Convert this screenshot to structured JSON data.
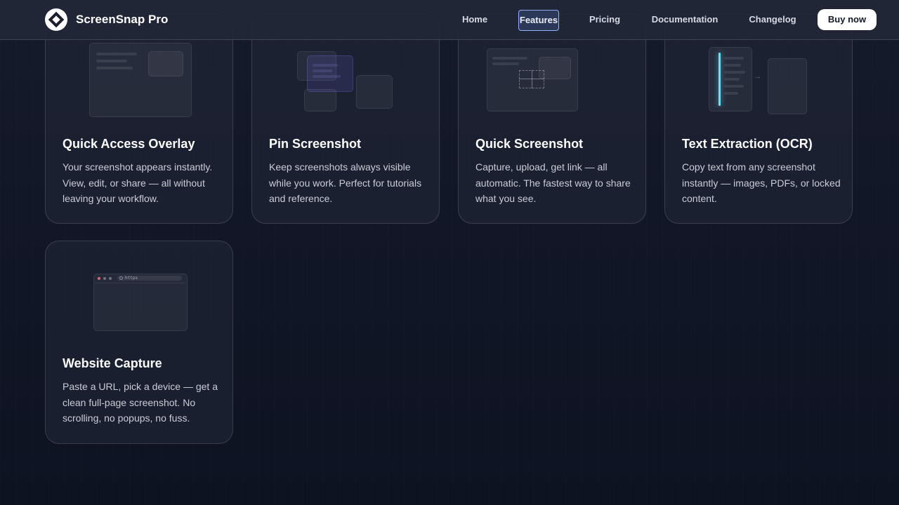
{
  "header": {
    "brand": "ScreenSnap Pro",
    "nav": [
      "Home",
      "Features",
      "Pricing",
      "Documentation",
      "Changelog"
    ],
    "active_nav": "Features",
    "cta_label": "Buy now"
  },
  "cards": [
    {
      "title": "Quick Access Overlay",
      "description": "Your screenshot appears instantly. View, edit, or share — all without leaving your workflow.",
      "illustration": "overlay-illustration"
    },
    {
      "title": "Pin Screenshot",
      "description": "Keep screenshots always visible while you work. Perfect for tutorials and reference.",
      "illustration": "pin-illustration"
    },
    {
      "title": "Quick Screenshot",
      "description": "Capture, upload, get link — all automatic. The fastest way to share what you see.",
      "illustration": "crosshair-illustration"
    },
    {
      "title": "Text Extraction (OCR)",
      "description": "Copy text from any screenshot instantly — images, PDFs, or locked content.",
      "illustration": "ocr-illustration"
    },
    {
      "title": "Website Capture",
      "description": "Paste a URL, pick a device — get a clean full-page screenshot. No scrolling, no popups, no fuss.",
      "illustration": "browser-illustration",
      "url_text": "https"
    }
  ],
  "colors": {
    "background": "#121727",
    "accent_cyan": "#5ee7f2",
    "active_nav_border": "#8fb2ff",
    "cta_bg": "#ffffff"
  }
}
